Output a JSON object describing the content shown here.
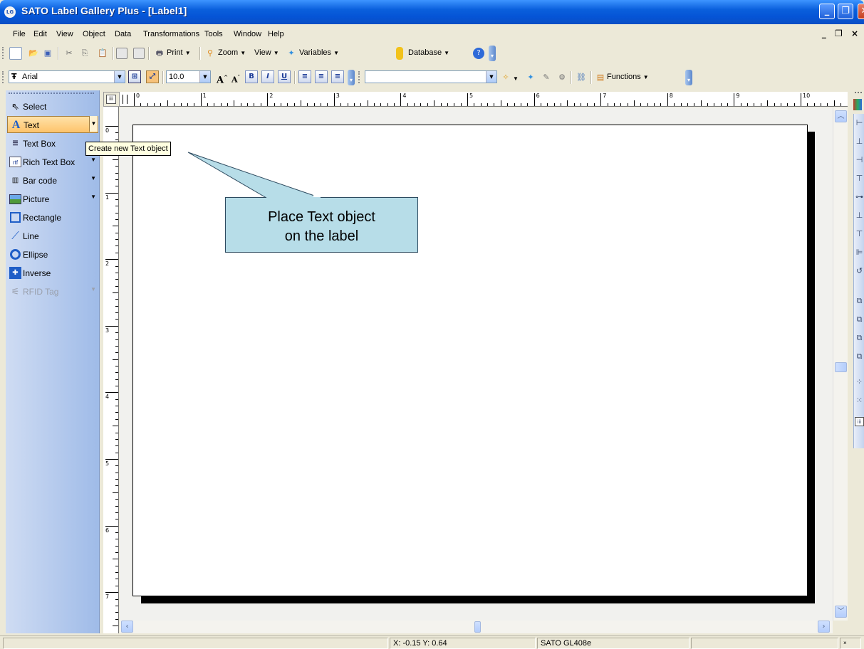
{
  "window": {
    "title": "SATO Label Gallery Plus - [Label1]",
    "app_icon_text": "LG",
    "title_bar_gradient": [
      "#3d95ff",
      "#0554d6"
    ]
  },
  "menu": {
    "items": [
      "File",
      "Edit",
      "View",
      "Object",
      "Data",
      "Transformations",
      "Tools",
      "Window",
      "Help"
    ]
  },
  "toolbar_main": {
    "print": "Print",
    "zoom": "Zoom",
    "view": "View",
    "variables": "Variables",
    "database": "Database"
  },
  "toolbar_format": {
    "font_name": "Arial",
    "font_size": "10.0",
    "second_combo_value": "",
    "functions": "Functions"
  },
  "tools": {
    "items": [
      {
        "label": "Select",
        "icon": "arrow-cursor-icon"
      },
      {
        "label": "Text",
        "icon": "text-a-icon",
        "selected": true
      },
      {
        "label": "Text Box",
        "icon": "text-box-icon"
      },
      {
        "label": "Rich Text Box",
        "icon": "rtf-icon"
      },
      {
        "label": "Bar code",
        "icon": "barcode-icon"
      },
      {
        "label": "Picture",
        "icon": "picture-icon"
      },
      {
        "label": "Rectangle",
        "icon": "rectangle-icon"
      },
      {
        "label": "Line",
        "icon": "line-icon"
      },
      {
        "label": "Ellipse",
        "icon": "ellipse-icon"
      },
      {
        "label": "Inverse",
        "icon": "inverse-icon"
      },
      {
        "label": "RFID Tag",
        "icon": "rfid-icon",
        "disabled": true
      }
    ]
  },
  "tooltip": "Create new Text object",
  "callout": "Place Text object\non the label",
  "rulers": {
    "h_labels": [
      "0",
      "1",
      "2",
      "3",
      "4",
      "5",
      "6",
      "7",
      "8",
      "9",
      "10"
    ],
    "v_labels": [
      "0",
      "1",
      "2",
      "3",
      "4",
      "5",
      "6",
      "7"
    ]
  },
  "status": {
    "coords": "X: -0.15 Y:  0.64",
    "printer": "SATO GL408e"
  },
  "colors": {
    "selected_tool": "#fdc36b",
    "callout_fill": "#b7dde8",
    "tooltip_fill": "#ffffe1"
  }
}
